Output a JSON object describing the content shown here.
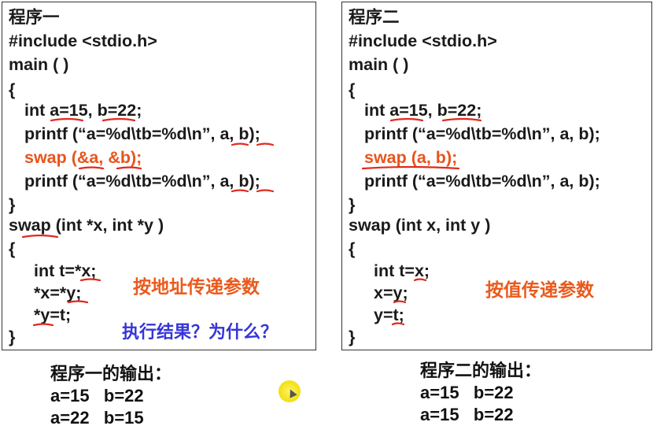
{
  "left": {
    "title": "程序一",
    "include": "#include <stdio.h>",
    "main": "main ( )",
    "open_brace": "{",
    "decl": "int a=15, b=22;",
    "printf1": "printf (“a=%d\\tb=%d\\n”, a, b);",
    "swap_call": "swap (&a, &b);",
    "printf2": "printf (“a=%d\\tb=%d\\n”, a, b);",
    "close_brace": "}",
    "swap_def": "swap (int *x, int *y )",
    "open_brace2": "{",
    "body1": "int t=*x;",
    "body2": "*x=*y;",
    "body3": "*y=t;",
    "close_brace2": "}",
    "note": "按地址传递参数",
    "question": "执行结果？为什么？"
  },
  "right": {
    "title": "程序二",
    "include": "#include <stdio.h>",
    "main": "main ( )",
    "open_brace": "{",
    "decl": "int a=15, b=22;",
    "printf1": "printf (“a=%d\\tb=%d\\n”, a, b);",
    "swap_call": "swap (a, b);",
    "printf2": "printf (“a=%d\\tb=%d\\n”, a, b);",
    "close_brace": "}",
    "swap_def": "swap (int x, int y )",
    "open_brace2": "{",
    "body1": "int t=x;",
    "body2": "x=y;",
    "body3": "y=t;",
    "close_brace2": "}",
    "note": "按值传递参数"
  },
  "output_left": {
    "heading": "程序一的输出：",
    "row1": "a=15   b=22",
    "row2": "a=22   b=15"
  },
  "output_right": {
    "heading": "程序二的输出：",
    "row1": "a=15   b=22",
    "row2": "a=15   b=22"
  }
}
